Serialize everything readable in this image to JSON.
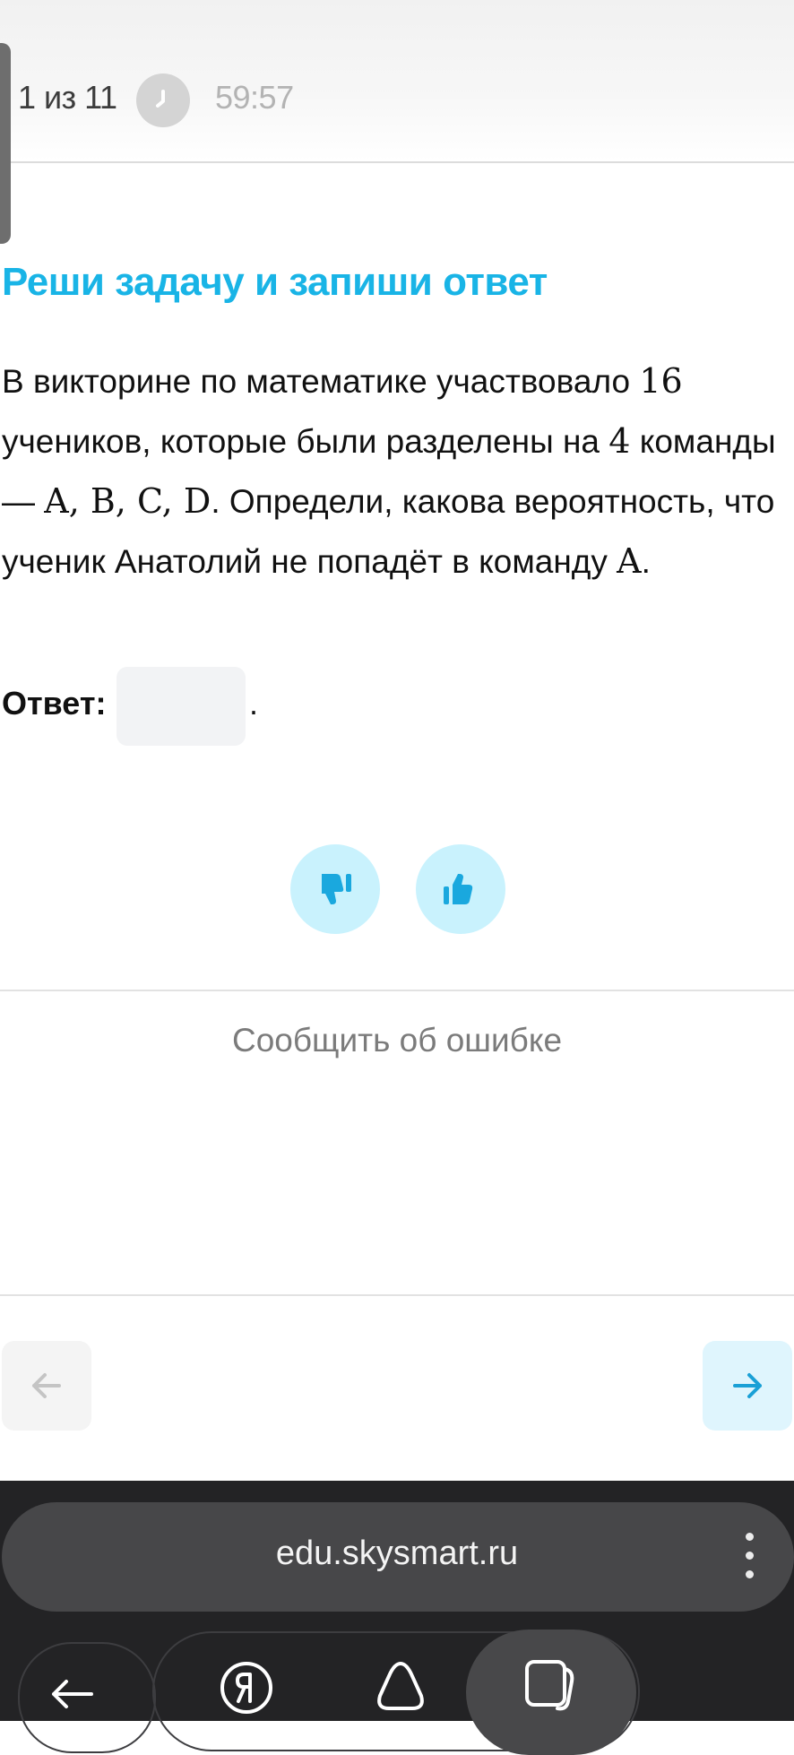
{
  "header": {
    "progress": "1 из 11",
    "timer": "59:57"
  },
  "task": {
    "title": "Реши задачу и запиши ответ",
    "text_parts": {
      "p1": "В викторине по математике участвовало ",
      "n1": "16",
      "p2": " учеников, которые были разделены на ",
      "n2": "4",
      "p3": " команды — ",
      "teams": "A, B, C, D",
      "p4": ". Определи, какова вероятность, что ученик Анатолий не попадёт в команду ",
      "team_a": "A",
      "p5": "."
    },
    "answer_label": "Ответ:",
    "answer_value": "",
    "answer_suffix": "."
  },
  "feedback": {
    "report_error": "Сообщить об ошибке"
  },
  "browser": {
    "url": "edu.skysmart.ru"
  },
  "colors": {
    "accent": "#19b4e6",
    "feedback_bg": "#c9f2fd",
    "next_bg": "#dff5fd",
    "browser_bg": "#232325"
  },
  "icons": {
    "clock": "clock-icon",
    "dislike": "thumbs-down-icon",
    "like": "thumbs-up-icon",
    "prev": "arrow-left-icon",
    "next": "arrow-right-icon",
    "menu": "more-vertical-icon",
    "back": "back-arrow-icon",
    "yandex": "yandex-logo-icon",
    "home": "home-shape-icon",
    "tabs": "tabs-icon"
  }
}
